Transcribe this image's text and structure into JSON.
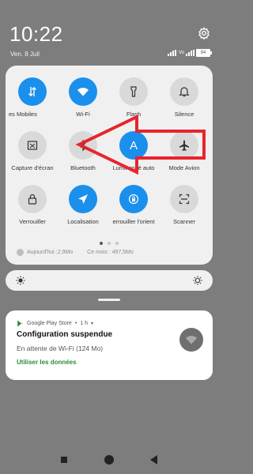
{
  "status": {
    "time": "10:22",
    "date": "Ven. 8 Juil",
    "network_type": "Vo",
    "battery": "94"
  },
  "tiles": [
    {
      "label": "es Mobiles",
      "state": "on",
      "icon": "data-arrows-icon"
    },
    {
      "label": "Wi-Fi",
      "state": "on",
      "icon": "wifi-icon"
    },
    {
      "label": "Flash",
      "state": "off",
      "icon": "flashlight-icon"
    },
    {
      "label": "Silence",
      "state": "off",
      "icon": "bell-icon"
    },
    {
      "label": "Capture d'écran",
      "state": "off",
      "icon": "screenshot-icon"
    },
    {
      "label": "Bluetooth",
      "state": "off",
      "icon": "bluetooth-icon"
    },
    {
      "label": "Luminosité auto",
      "state": "on",
      "icon": "auto-brightness-icon",
      "glyph": "A"
    },
    {
      "label": "Mode Avion",
      "state": "off",
      "icon": "airplane-icon"
    },
    {
      "label": "Verrouiller",
      "state": "off",
      "icon": "lock-icon"
    },
    {
      "label": "Localisation",
      "state": "on",
      "icon": "location-icon"
    },
    {
      "label": "errouiller l'orient",
      "state": "on",
      "icon": "rotation-lock-icon"
    },
    {
      "label": "Scanner",
      "state": "off",
      "icon": "scanner-icon"
    }
  ],
  "data_usage": {
    "today": "Aujourd'hui :2,9Mo",
    "month": "Ce mois : 497,5Mo"
  },
  "notification": {
    "app": "Google Play Store",
    "time": "1 h",
    "title": "Configuration suspendue",
    "text": "En attente de Wi-Fi (124 Mo)",
    "action": "Utiliser les données"
  },
  "colors": {
    "tile_on": "#1a90ec",
    "tile_off": "#d9d9d9",
    "annotation_arrow": "#e8242c",
    "action_text": "#2f8a3a"
  }
}
